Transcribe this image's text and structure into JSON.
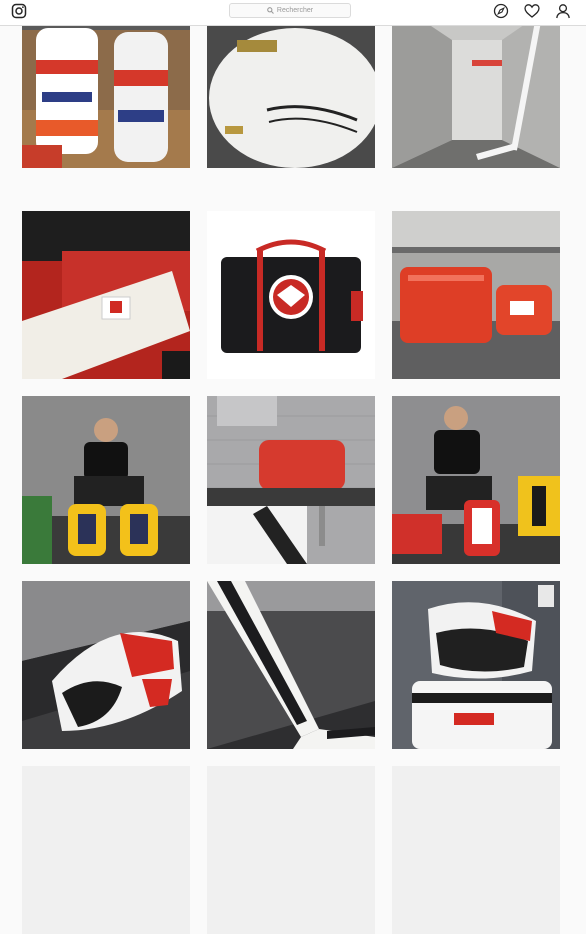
{
  "header": {
    "search_placeholder": "Rechercher",
    "icons": [
      "instagram-logo-icon",
      "explore-compass-icon",
      "activity-heart-icon",
      "profile-person-icon"
    ]
  },
  "feed": {
    "posts": [
      {
        "name": "post-goalie-pads-red-white-blue",
        "palette": "#c93a2d"
      },
      {
        "name": "post-catcher-glove-white",
        "palette": "#e6e6e6"
      },
      {
        "name": "post-goalie-stick-hallway",
        "palette": "#b8b8b8"
      },
      {
        "name": "post-red-gear-canada-patch",
        "palette": "#b3251e"
      },
      {
        "name": "post-black-hockey-bag-eagle-logo",
        "palette": "#222222"
      },
      {
        "name": "post-red-bags-on-floor",
        "palette": "#d8422b"
      },
      {
        "name": "post-player-putting-on-yellow-pads",
        "palette": "#6f6f6f"
      },
      {
        "name": "post-red-toiletry-bag-on-bench",
        "palette": "#9b9b9b"
      },
      {
        "name": "post-player-seated-with-gear",
        "palette": "#707070"
      },
      {
        "name": "post-blocker-on-bench",
        "palette": "#404040"
      },
      {
        "name": "post-goalie-stick-closeup",
        "palette": "#3f3f3f"
      },
      {
        "name": "post-blocker-on-white-pad",
        "palette": "#585c63"
      }
    ]
  }
}
